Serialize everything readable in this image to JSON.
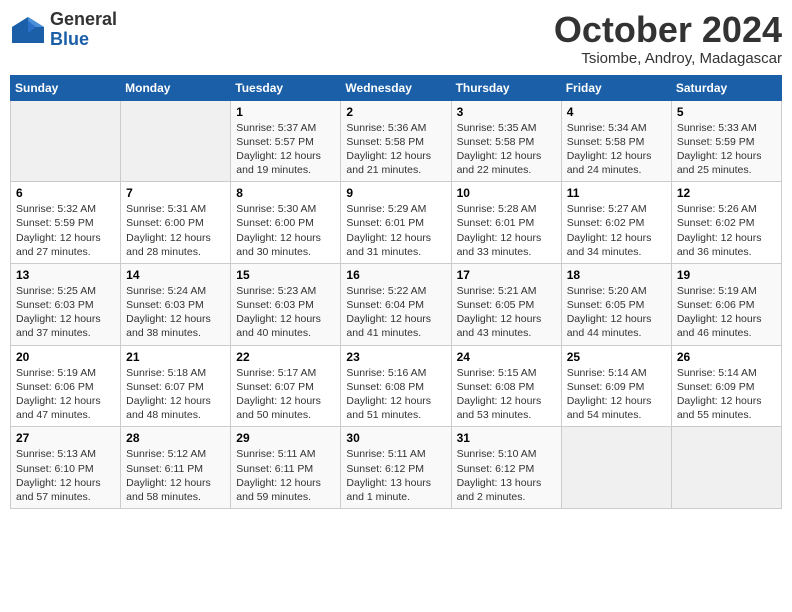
{
  "header": {
    "logo_general": "General",
    "logo_blue": "Blue",
    "month_title": "October 2024",
    "subtitle": "Tsiombe, Androy, Madagascar"
  },
  "weekdays": [
    "Sunday",
    "Monday",
    "Tuesday",
    "Wednesday",
    "Thursday",
    "Friday",
    "Saturday"
  ],
  "weeks": [
    [
      {
        "day": "",
        "info": ""
      },
      {
        "day": "",
        "info": ""
      },
      {
        "day": "1",
        "info": "Sunrise: 5:37 AM\nSunset: 5:57 PM\nDaylight: 12 hours\nand 19 minutes."
      },
      {
        "day": "2",
        "info": "Sunrise: 5:36 AM\nSunset: 5:58 PM\nDaylight: 12 hours\nand 21 minutes."
      },
      {
        "day": "3",
        "info": "Sunrise: 5:35 AM\nSunset: 5:58 PM\nDaylight: 12 hours\nand 22 minutes."
      },
      {
        "day": "4",
        "info": "Sunrise: 5:34 AM\nSunset: 5:58 PM\nDaylight: 12 hours\nand 24 minutes."
      },
      {
        "day": "5",
        "info": "Sunrise: 5:33 AM\nSunset: 5:59 PM\nDaylight: 12 hours\nand 25 minutes."
      }
    ],
    [
      {
        "day": "6",
        "info": "Sunrise: 5:32 AM\nSunset: 5:59 PM\nDaylight: 12 hours\nand 27 minutes."
      },
      {
        "day": "7",
        "info": "Sunrise: 5:31 AM\nSunset: 6:00 PM\nDaylight: 12 hours\nand 28 minutes."
      },
      {
        "day": "8",
        "info": "Sunrise: 5:30 AM\nSunset: 6:00 PM\nDaylight: 12 hours\nand 30 minutes."
      },
      {
        "day": "9",
        "info": "Sunrise: 5:29 AM\nSunset: 6:01 PM\nDaylight: 12 hours\nand 31 minutes."
      },
      {
        "day": "10",
        "info": "Sunrise: 5:28 AM\nSunset: 6:01 PM\nDaylight: 12 hours\nand 33 minutes."
      },
      {
        "day": "11",
        "info": "Sunrise: 5:27 AM\nSunset: 6:02 PM\nDaylight: 12 hours\nand 34 minutes."
      },
      {
        "day": "12",
        "info": "Sunrise: 5:26 AM\nSunset: 6:02 PM\nDaylight: 12 hours\nand 36 minutes."
      }
    ],
    [
      {
        "day": "13",
        "info": "Sunrise: 5:25 AM\nSunset: 6:03 PM\nDaylight: 12 hours\nand 37 minutes."
      },
      {
        "day": "14",
        "info": "Sunrise: 5:24 AM\nSunset: 6:03 PM\nDaylight: 12 hours\nand 38 minutes."
      },
      {
        "day": "15",
        "info": "Sunrise: 5:23 AM\nSunset: 6:03 PM\nDaylight: 12 hours\nand 40 minutes."
      },
      {
        "day": "16",
        "info": "Sunrise: 5:22 AM\nSunset: 6:04 PM\nDaylight: 12 hours\nand 41 minutes."
      },
      {
        "day": "17",
        "info": "Sunrise: 5:21 AM\nSunset: 6:05 PM\nDaylight: 12 hours\nand 43 minutes."
      },
      {
        "day": "18",
        "info": "Sunrise: 5:20 AM\nSunset: 6:05 PM\nDaylight: 12 hours\nand 44 minutes."
      },
      {
        "day": "19",
        "info": "Sunrise: 5:19 AM\nSunset: 6:06 PM\nDaylight: 12 hours\nand 46 minutes."
      }
    ],
    [
      {
        "day": "20",
        "info": "Sunrise: 5:19 AM\nSunset: 6:06 PM\nDaylight: 12 hours\nand 47 minutes."
      },
      {
        "day": "21",
        "info": "Sunrise: 5:18 AM\nSunset: 6:07 PM\nDaylight: 12 hours\nand 48 minutes."
      },
      {
        "day": "22",
        "info": "Sunrise: 5:17 AM\nSunset: 6:07 PM\nDaylight: 12 hours\nand 50 minutes."
      },
      {
        "day": "23",
        "info": "Sunrise: 5:16 AM\nSunset: 6:08 PM\nDaylight: 12 hours\nand 51 minutes."
      },
      {
        "day": "24",
        "info": "Sunrise: 5:15 AM\nSunset: 6:08 PM\nDaylight: 12 hours\nand 53 minutes."
      },
      {
        "day": "25",
        "info": "Sunrise: 5:14 AM\nSunset: 6:09 PM\nDaylight: 12 hours\nand 54 minutes."
      },
      {
        "day": "26",
        "info": "Sunrise: 5:14 AM\nSunset: 6:09 PM\nDaylight: 12 hours\nand 55 minutes."
      }
    ],
    [
      {
        "day": "27",
        "info": "Sunrise: 5:13 AM\nSunset: 6:10 PM\nDaylight: 12 hours\nand 57 minutes."
      },
      {
        "day": "28",
        "info": "Sunrise: 5:12 AM\nSunset: 6:11 PM\nDaylight: 12 hours\nand 58 minutes."
      },
      {
        "day": "29",
        "info": "Sunrise: 5:11 AM\nSunset: 6:11 PM\nDaylight: 12 hours\nand 59 minutes."
      },
      {
        "day": "30",
        "info": "Sunrise: 5:11 AM\nSunset: 6:12 PM\nDaylight: 13 hours\nand 1 minute."
      },
      {
        "day": "31",
        "info": "Sunrise: 5:10 AM\nSunset: 6:12 PM\nDaylight: 13 hours\nand 2 minutes."
      },
      {
        "day": "",
        "info": ""
      },
      {
        "day": "",
        "info": ""
      }
    ]
  ]
}
